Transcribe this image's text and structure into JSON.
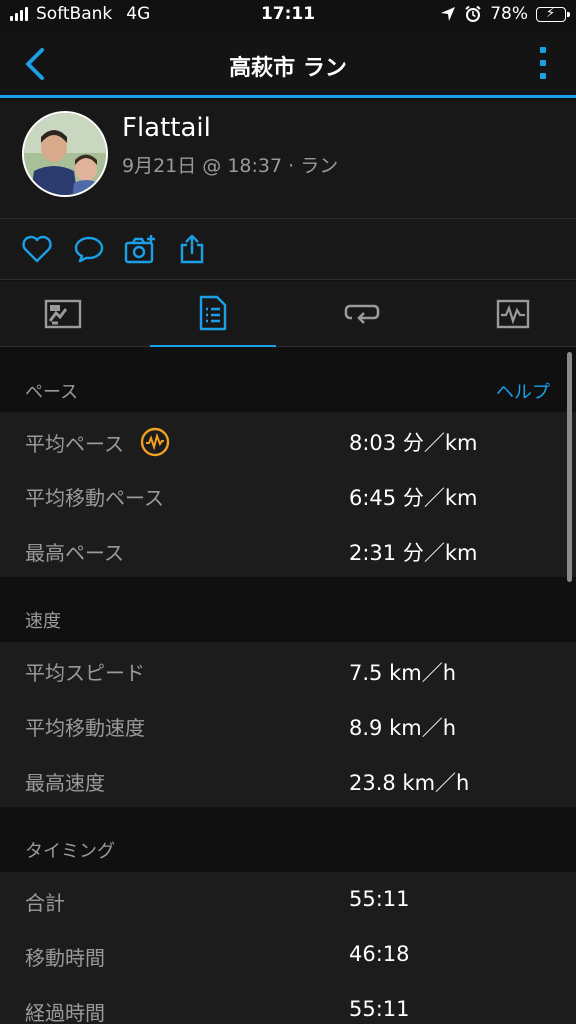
{
  "status_bar": {
    "carrier": "SoftBank",
    "network": "4G",
    "time": "17:11",
    "battery": "78%",
    "battery_fraction": 0.78,
    "icons": [
      "signal-icon",
      "location-arrow-icon",
      "alarm-icon",
      "battery-charging-icon"
    ]
  },
  "nav": {
    "title": "高萩市 ラン",
    "accent_color": "#1aa0e6"
  },
  "profile": {
    "name": "Flattail",
    "meta": "9月21日 @ 18:37 · ラン"
  },
  "actions": [
    "heart-icon",
    "comment-icon",
    "add-photo-icon",
    "share-icon"
  ],
  "tabs": [
    {
      "icon": "map-icon",
      "active": false
    },
    {
      "icon": "stats-list-icon",
      "active": true
    },
    {
      "icon": "laps-icon",
      "active": false
    },
    {
      "icon": "chart-icon",
      "active": false
    }
  ],
  "sections": {
    "pace": {
      "title": "ペース",
      "help": "ヘルプ",
      "rows": [
        {
          "label": "平均ペース",
          "value": "8:03 分／km",
          "badge": "pace-graph-icon"
        },
        {
          "label": "平均移動ペース",
          "value": "6:45 分／km"
        },
        {
          "label": "最高ペース",
          "value": "2:31 分／km"
        }
      ]
    },
    "speed": {
      "title": "速度",
      "rows": [
        {
          "label": "平均スピード",
          "value": "7.5 km／h"
        },
        {
          "label": "平均移動速度",
          "value": "8.9 km／h"
        },
        {
          "label": "最高速度",
          "value": "23.8 km／h"
        }
      ]
    },
    "timing": {
      "title": "タイミング",
      "rows": [
        {
          "label": "合計",
          "value": "55:11"
        },
        {
          "label": "移動時間",
          "value": "46:18"
        },
        {
          "label": "経過時間",
          "value": "55:11"
        }
      ]
    }
  }
}
